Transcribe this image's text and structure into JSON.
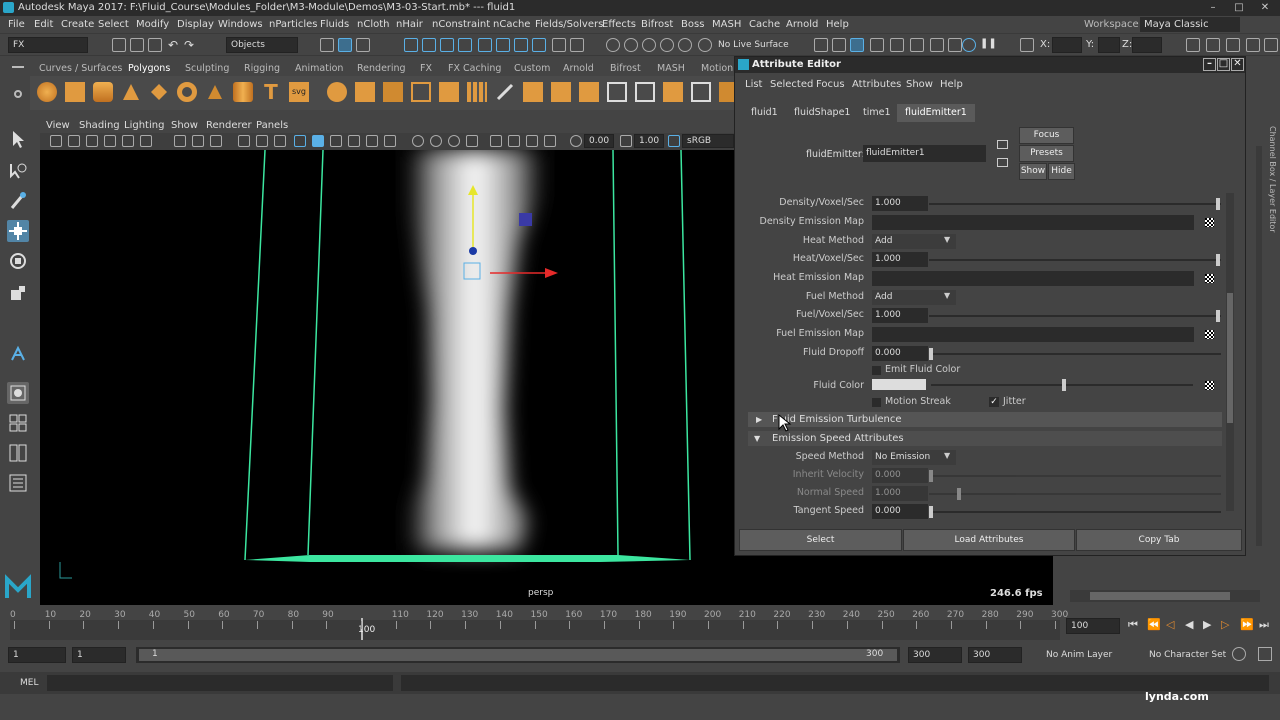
{
  "window": {
    "title": "Autodesk Maya 2017: F:\\Fluid_Course\\Modules_Folder\\M3-Module\\Demos\\M3-03-Start.mb*  ---  fluid1"
  },
  "menubar": [
    "File",
    "Edit",
    "Create",
    "Select",
    "Modify",
    "Display",
    "Windows",
    "nParticles",
    "Fluids",
    "nCloth",
    "nHair",
    "nConstraint",
    "nCache",
    "Fields/Solvers",
    "Effects",
    "Bifrost",
    "Boss",
    "MASH",
    "Cache",
    "Arnold",
    "Help"
  ],
  "workspace": {
    "label": "Workspace :",
    "value": "Maya Classic"
  },
  "statusline": {
    "mode": "FX",
    "objects": "Objects",
    "live_surface": "No Live Surface",
    "x_label": "X:",
    "y_label": "Y:",
    "z_label": "Z:"
  },
  "shelf_tabs": [
    "Curves / Surfaces",
    "Polygons",
    "Sculpting",
    "Rigging",
    "Animation",
    "Rendering",
    "FX",
    "FX Caching",
    "Custom",
    "Arnold",
    "Bifrost",
    "MASH",
    "Motion"
  ],
  "viewport": {
    "menus": [
      "View",
      "Shading",
      "Lighting",
      "Show",
      "Renderer",
      "Panels"
    ],
    "exposure": "0.00",
    "gamma": "1.00",
    "color_space": "sRGB gamm",
    "camera": "persp",
    "fps": "246.6 fps"
  },
  "attribute_editor": {
    "title": "Attribute Editor",
    "menus": [
      "List",
      "Selected",
      "Focus",
      "Attributes",
      "Show",
      "Help"
    ],
    "tabs": [
      "fluid1",
      "fluidShape1",
      "time1",
      "fluidEmitter1"
    ],
    "node_label": "fluidEmitter:",
    "node_value": "fluidEmitter1",
    "focus": "Focus",
    "presets": "Presets",
    "show": "Show",
    "hide": "Hide",
    "rows": {
      "density_voxel": {
        "label": "Density/Voxel/Sec",
        "value": "1.000"
      },
      "density_map": {
        "label": "Density Emission Map"
      },
      "heat_method": {
        "label": "Heat Method",
        "value": "Add"
      },
      "heat_voxel": {
        "label": "Heat/Voxel/Sec",
        "value": "1.000"
      },
      "heat_map": {
        "label": "Heat Emission Map"
      },
      "fuel_method": {
        "label": "Fuel Method",
        "value": "Add"
      },
      "fuel_voxel": {
        "label": "Fuel/Voxel/Sec",
        "value": "1.000"
      },
      "fuel_map": {
        "label": "Fuel Emission Map"
      },
      "fluid_dropoff": {
        "label": "Fluid Dropoff",
        "value": "0.000"
      },
      "emit_color": {
        "label": "Emit Fluid Color"
      },
      "fluid_color": {
        "label": "Fluid Color"
      },
      "motion_streak": {
        "label": "Motion Streak"
      },
      "jitter": {
        "label": "Jitter"
      },
      "speed_method": {
        "label": "Speed Method",
        "value": "No Emission"
      },
      "inherit_velocity": {
        "label": "Inherit Velocity",
        "value": "0.000"
      },
      "normal_speed": {
        "label": "Normal Speed",
        "value": "1.000"
      },
      "tangent_speed": {
        "label": "Tangent Speed",
        "value": "0.000"
      }
    },
    "sections": {
      "turbulence": "Fluid Emission Turbulence",
      "speed": "Emission Speed Attributes"
    },
    "buttons": {
      "select": "Select",
      "load": "Load Attributes",
      "copy": "Copy Tab"
    }
  },
  "timeline": {
    "ticks": [
      "0",
      "10",
      "20",
      "30",
      "40",
      "50",
      "60",
      "70",
      "80",
      "90",
      "100",
      "110",
      "120",
      "130",
      "140",
      "150",
      "160",
      "170",
      "180",
      "190",
      "200",
      "210",
      "220",
      "230",
      "240",
      "250",
      "260",
      "270",
      "280",
      "290",
      "300"
    ],
    "current": "100",
    "current_field": "100"
  },
  "range": {
    "start": "1",
    "start2": "1",
    "slider_start": "1",
    "slider_end": "300",
    "end": "300",
    "end2": "300",
    "anim_layer": "No Anim Layer",
    "char_set": "No Character Set"
  },
  "mel": {
    "label": "MEL"
  },
  "watermark": "lynda.com",
  "side_tabs": "Channel Box / Layer Editor"
}
